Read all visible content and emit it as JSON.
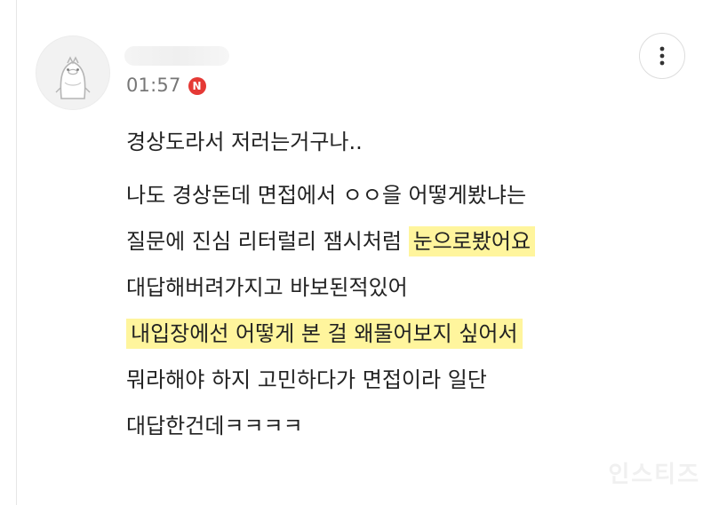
{
  "comment": {
    "time": "01:57",
    "new_badge": "N",
    "lines": {
      "l1": "경상도라서 저러는거구나..",
      "l2": "나도 경상돈데 면접에서 ㅇㅇ을 어떻게봤냐는",
      "l3a": "질문에 진심 리터럴리 잼시처럼 ",
      "l3b": "눈으로봤어요",
      "l4": "대답해버려가지고 바보된적있어",
      "l5": "내입장에선 어떻게 본 걸 왜물어보지 싶어서",
      "l6": "뭐라해야 하지 고민하다가 면접이라 일단",
      "l7": "대답한건데ㅋㅋㅋㅋ"
    }
  },
  "icons": {
    "avatar": "penguin-avatar-icon",
    "more": "more-vertical-icon"
  },
  "colors": {
    "highlight": "#fff59d",
    "badge": "#e53935",
    "time": "#777777",
    "text": "#222222"
  },
  "watermark": "인스티즈"
}
